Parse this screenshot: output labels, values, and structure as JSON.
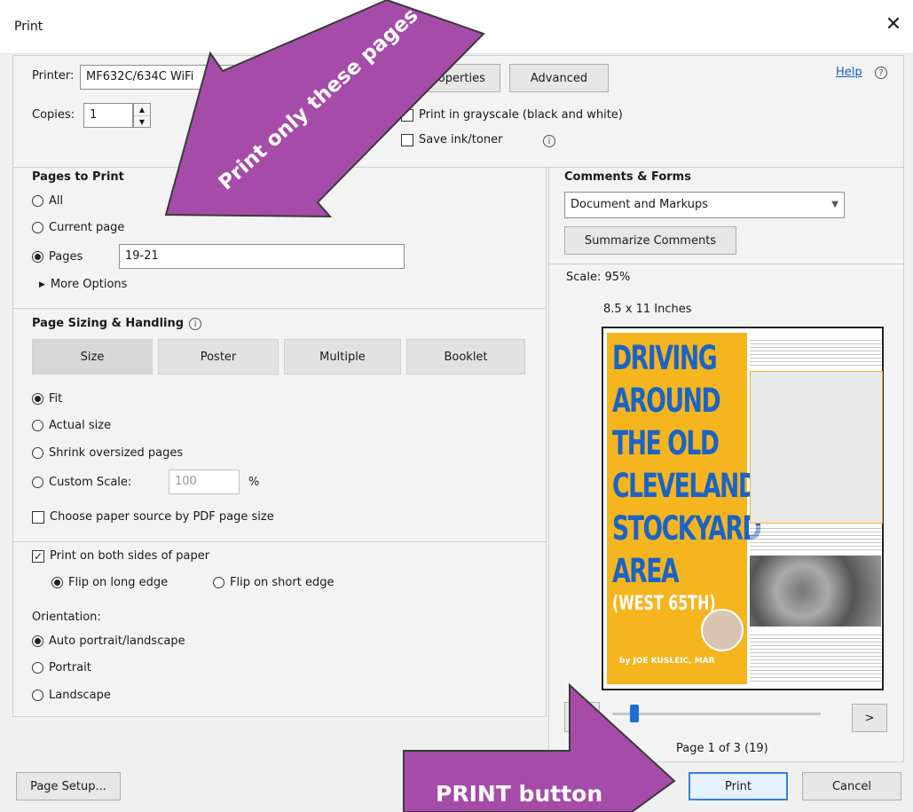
{
  "window": {
    "title": "Print",
    "close_glyph": "✕"
  },
  "printer": {
    "label": "Printer:",
    "value": "MF632C/634C WiFi",
    "properties_label": "Properties",
    "advanced_label": "Advanced",
    "help_label": "Help",
    "help_glyph": "?"
  },
  "copies": {
    "label": "Copies:",
    "value": "1"
  },
  "options": {
    "grayscale_label": "Print in grayscale (black and white)",
    "grayscale_checked": false,
    "save_ink_label": "Save ink/toner",
    "save_ink_checked": false
  },
  "pages_to_print": {
    "heading": "Pages to Print",
    "all_label": "All",
    "current_label": "Current page",
    "pages_label": "Pages",
    "pages_value": "19-21",
    "selected": "pages",
    "more_options_label": "More Options"
  },
  "page_sizing": {
    "heading": "Page Sizing & Handling",
    "tabs": [
      "Size",
      "Poster",
      "Multiple",
      "Booklet"
    ],
    "fit_label": "Fit",
    "actual_label": "Actual size",
    "shrink_label": "Shrink oversized pages",
    "custom_label": "Custom Scale:",
    "custom_value": "100",
    "custom_unit": "%",
    "selected": "fit",
    "paper_source_label": "Choose paper source by PDF page size",
    "paper_source_checked": false
  },
  "duplex": {
    "both_sides_label": "Print on both sides of paper",
    "both_sides_checked": true,
    "long_edge_label": "Flip on long edge",
    "short_edge_label": "Flip on short edge",
    "selected": "long"
  },
  "orientation": {
    "heading": "Orientation:",
    "auto_label": "Auto portrait/landscape",
    "portrait_label": "Portrait",
    "landscape_label": "Landscape",
    "selected": "auto"
  },
  "comments_forms": {
    "heading": "Comments & Forms",
    "value": "Document and Markups",
    "summarize_label": "Summarize Comments"
  },
  "preview": {
    "scale_label": "Scale: 95%",
    "paper_label": "8.5 x 11 Inches",
    "cover_title_lines": [
      "DRIVING",
      "AROUND",
      "THE OLD",
      "CLEVELAND",
      "STOCKYARD",
      "AREA"
    ],
    "cover_subtitle": "(WEST 65TH)",
    "cover_author": "by JOE KUSLEIC, MAR",
    "next_glyph": ">",
    "page_label": "Page 1 of 3 (19)",
    "slider_level": 0.08
  },
  "footer": {
    "page_setup_label": "Page Setup...",
    "print_label": "Print",
    "cancel_label": "Cancel"
  },
  "annotations": {
    "arrow1_text": "Print only these pages",
    "arrow2_text": "PRINT button",
    "color": "#a54ca8"
  }
}
